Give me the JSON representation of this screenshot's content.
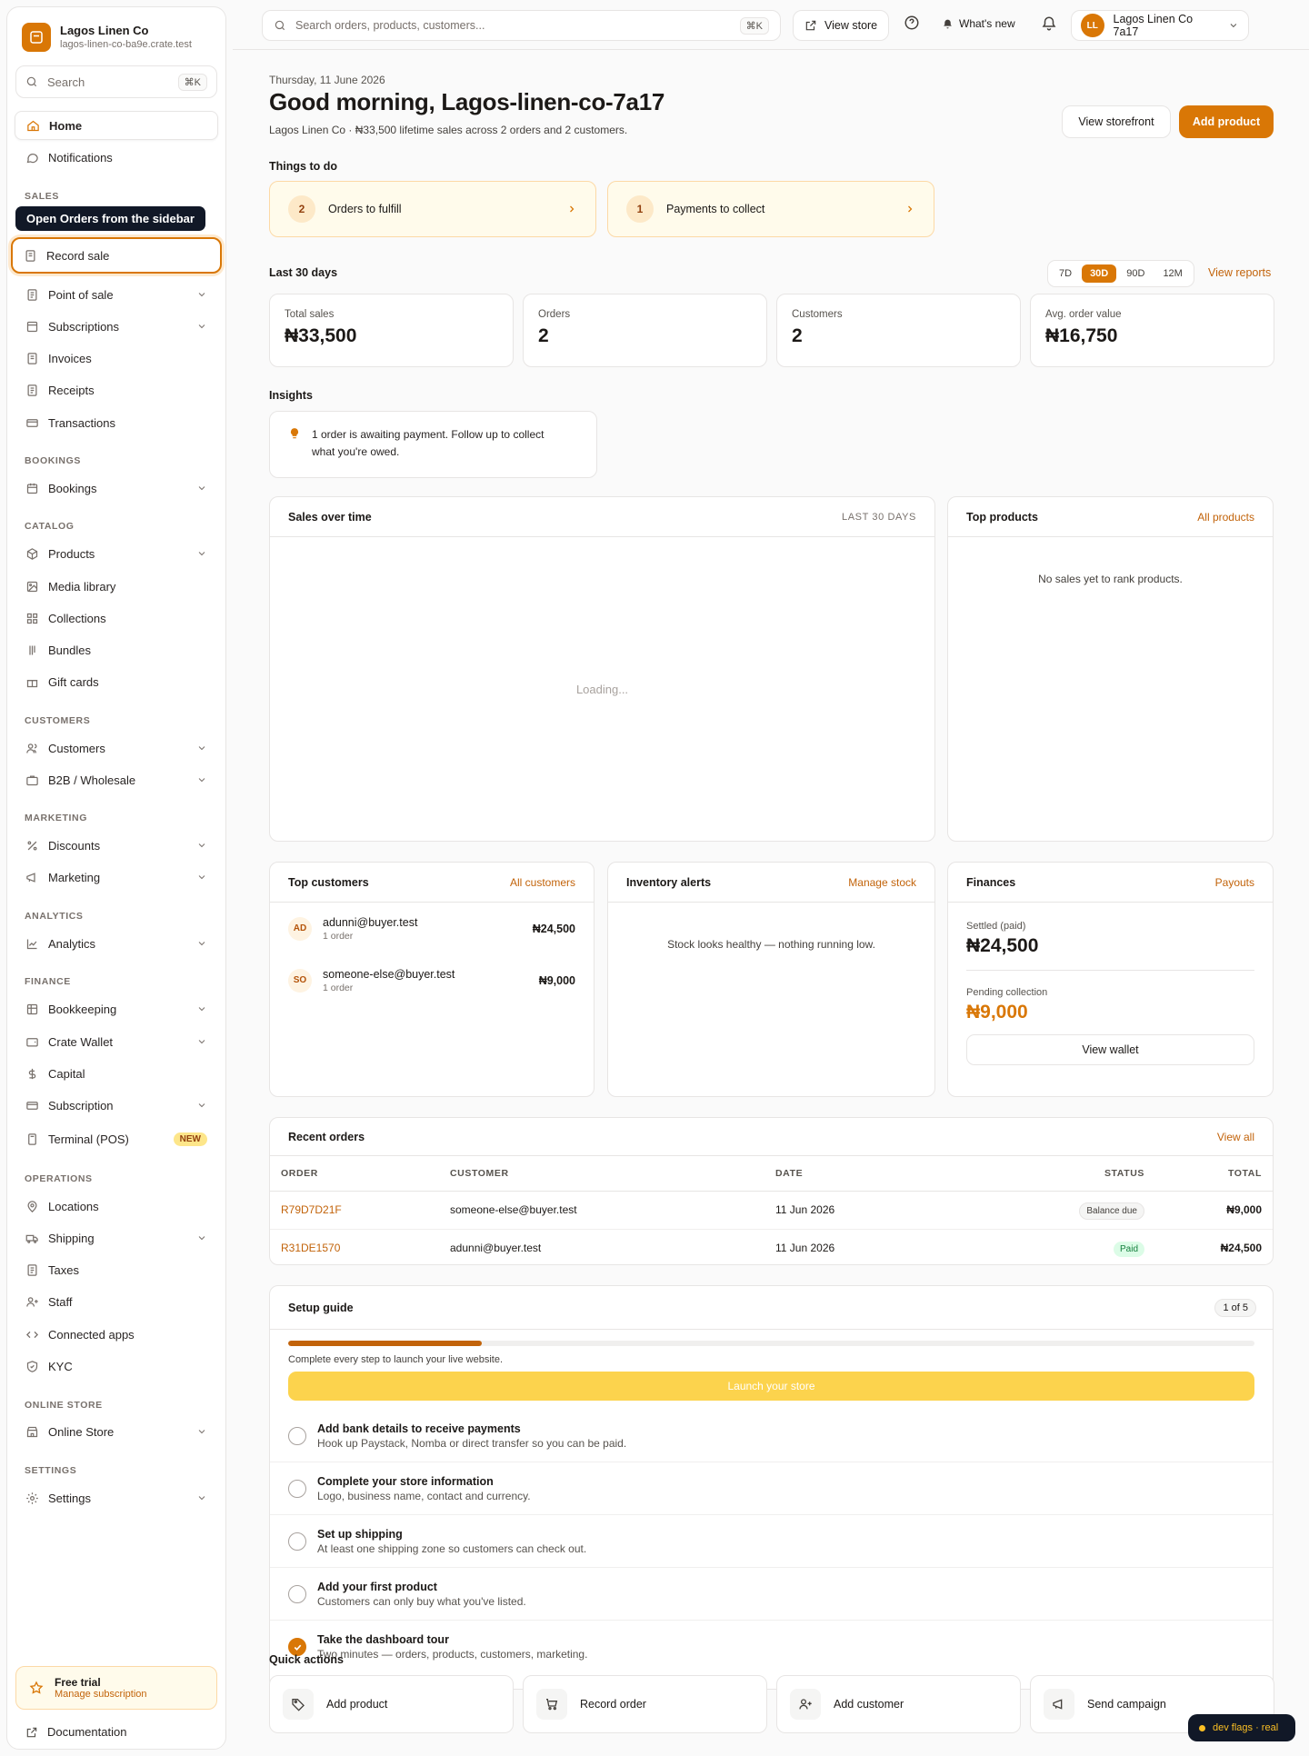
{
  "brand": {
    "name": "Lagos Linen Co",
    "url": "lagos-linen-co-ba9e.crate.test"
  },
  "sidebar": {
    "search_label": "Search",
    "search_kbd": "⌘K",
    "tooltip": "Open Orders from the sidebar",
    "items": {
      "home": "Home",
      "notifications": "Notifications",
      "record_sale": "Record sale",
      "point_of_sale": "Point of sale",
      "subscriptions": "Subscriptions",
      "invoices": "Invoices",
      "receipts": "Receipts",
      "transactions": "Transactions",
      "bookings": "Bookings",
      "products": "Products",
      "media_library": "Media library",
      "collections": "Collections",
      "bundles": "Bundles",
      "gift_cards": "Gift cards",
      "customers": "Customers",
      "b2b": "B2B / Wholesale",
      "discounts": "Discounts",
      "marketing": "Marketing",
      "analytics": "Analytics",
      "bookkeeping": "Bookkeeping",
      "crate_wallet": "Crate Wallet",
      "capital": "Capital",
      "subscription": "Subscription",
      "terminal": "Terminal (POS)",
      "locations": "Locations",
      "shipping": "Shipping",
      "taxes": "Taxes",
      "staff": "Staff",
      "connected_apps": "Connected apps",
      "kyc": "KYC",
      "online_store": "Online Store",
      "settings": "Settings"
    },
    "new_badge": "NEW",
    "sections": {
      "sales": "SALES",
      "bookings": "BOOKINGS",
      "catalog": "CATALOG",
      "customers": "CUSTOMERS",
      "marketing": "MARKETING",
      "analytics": "ANALYTICS",
      "finance": "FINANCE",
      "operations": "OPERATIONS",
      "online_store": "ONLINE STORE",
      "settings": "SETTINGS"
    },
    "trial": {
      "title": "Free trial",
      "subtitle": "Manage subscription"
    },
    "docs": "Documentation"
  },
  "topbar": {
    "search_placeholder": "Search orders, products, customers...",
    "search_kbd": "⌘K",
    "view_store": "View store",
    "whats_new": "What's new",
    "account": "Lagos Linen Co 7a17",
    "initials": "LL"
  },
  "header": {
    "date": "Thursday, 11 June 2026",
    "greeting": "Good morning, Lagos-linen-co-7a17",
    "subline": "Lagos Linen Co · ₦33,500 lifetime sales across 2 orders and 2 customers.",
    "view_storefront": "View storefront",
    "add_product": "Add product"
  },
  "todo": {
    "title": "Things to do",
    "items": [
      {
        "count": "2",
        "label": "Orders to fulfill"
      },
      {
        "count": "1",
        "label": "Payments to collect"
      }
    ]
  },
  "period": {
    "title": "Last 30 days",
    "options": [
      "7D",
      "30D",
      "90D",
      "12M"
    ],
    "selected": "30D",
    "view_reports": "View reports"
  },
  "stats": [
    {
      "label": "Total sales",
      "value": "₦33,500"
    },
    {
      "label": "Orders",
      "value": "2"
    },
    {
      "label": "Customers",
      "value": "2"
    },
    {
      "label": "Avg. order value",
      "value": "₦16,750"
    }
  ],
  "insights": {
    "title": "Insights",
    "line1": "1 order is awaiting payment. Follow up to collect",
    "line2": "what you're owed."
  },
  "sales_chart": {
    "title": "Sales over time",
    "period": "LAST 30 DAYS",
    "loading": "Loading..."
  },
  "top_products": {
    "title": "Top products",
    "link": "All products",
    "empty": "No sales yet to rank products."
  },
  "top_customers": {
    "title": "Top customers",
    "link": "All customers",
    "rows": [
      {
        "initials": "AD",
        "email": "adunni@buyer.test",
        "orders": "1 order",
        "amount": "₦24,500"
      },
      {
        "initials": "SO",
        "email": "someone-else@buyer.test",
        "orders": "1 order",
        "amount": "₦9,000"
      }
    ]
  },
  "inventory": {
    "title": "Inventory alerts",
    "link": "Manage stock",
    "empty": "Stock looks healthy — nothing running low."
  },
  "finances": {
    "title": "Finances",
    "link": "Payouts",
    "settled_label": "Settled (paid)",
    "settled_value": "₦24,500",
    "pending_label": "Pending collection",
    "pending_value": "₦9,000",
    "wallet_button": "View wallet"
  },
  "recent_orders": {
    "title": "Recent orders",
    "link": "View all",
    "columns": [
      "ORDER",
      "CUSTOMER",
      "DATE",
      "STATUS",
      "TOTAL"
    ],
    "rows": [
      {
        "order": "R79D7D21F",
        "customer": "someone-else@buyer.test",
        "date": "11 Jun 2026",
        "status": "Balance due",
        "total": "₦9,000"
      },
      {
        "order": "R31DE1570",
        "customer": "adunni@buyer.test",
        "date": "11 Jun 2026",
        "status": "Paid",
        "total": "₦24,500"
      }
    ]
  },
  "setup": {
    "title": "Setup guide",
    "progress_label": "1 of 5",
    "progress_fraction": 0.2,
    "note": "Complete every step to launch your live website.",
    "launch": "Launch your store",
    "steps": [
      {
        "title": "Add bank details to receive payments",
        "sub": "Hook up Paystack, Nomba or direct transfer so you can be paid.",
        "done": false
      },
      {
        "title": "Complete your store information",
        "sub": "Logo, business name, contact and currency.",
        "done": false
      },
      {
        "title": "Set up shipping",
        "sub": "At least one shipping zone so customers can check out.",
        "done": false
      },
      {
        "title": "Add your first product",
        "sub": "Customers can only buy what you've listed.",
        "done": false
      },
      {
        "title": "Take the dashboard tour",
        "sub": "Two minutes — orders, products, customers, marketing.",
        "done": true
      }
    ]
  },
  "quick_actions": {
    "title": "Quick actions",
    "items": [
      "Add product",
      "Record order",
      "Add customer",
      "Send campaign"
    ]
  },
  "dev_flags": "dev flags · real"
}
